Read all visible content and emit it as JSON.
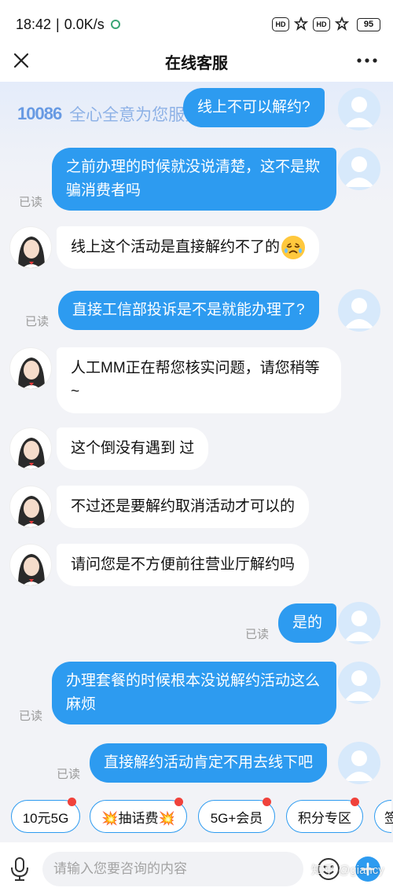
{
  "status_bar": {
    "time": "18:42",
    "network_speed": "0.0K/s",
    "icons": [
      "hd-icon",
      "signal-icon",
      "hd-icon",
      "signal-icon"
    ],
    "hd_label": "HD",
    "battery": "95"
  },
  "nav": {
    "title": "在线客服",
    "close_icon": "close-icon",
    "more_icon": "more-icon"
  },
  "banner": {
    "logo": "10086",
    "slogan": "全心全意为您服务"
  },
  "read_label": "已读",
  "messages": [
    {
      "from": "user",
      "text": "线上不可以解约?",
      "read": false
    },
    {
      "from": "user",
      "text": "之前办理的时候就没说清楚，这不是欺骗消费者吗",
      "read": true
    },
    {
      "from": "agent",
      "text": "线上这个活动是直接解约不了的"
    },
    {
      "from": "user",
      "text": "直接工信部投诉是不是就能办理了?",
      "read": true
    },
    {
      "from": "agent",
      "text": "人工MM正在帮您核实问题，请您稍等~"
    },
    {
      "from": "agent",
      "text": "这个倒没有遇到 过"
    },
    {
      "from": "agent",
      "text": "不过还是要解约取消活动才可以的"
    },
    {
      "from": "agent",
      "text": "请问您是不方便前往营业厅解约吗"
    },
    {
      "from": "user",
      "text": "是的",
      "read": true
    },
    {
      "from": "user",
      "text": "办理套餐的时候根本没说解约活动这么麻烦",
      "read": true
    },
    {
      "from": "user",
      "text": "直接解约活动肯定不用去线下吧",
      "read": true
    }
  ],
  "quick_replies": [
    {
      "label": "10元5G",
      "dot": true
    },
    {
      "label": "💥抽话费💥",
      "dot": true
    },
    {
      "label": "5G+会员",
      "dot": true
    },
    {
      "label": "积分专区",
      "dot": true
    },
    {
      "label": "签",
      "dot": false
    }
  ],
  "input": {
    "placeholder": "请输入您要咨询的内容",
    "mic_icon": "mic-icon",
    "emoji_icon": "emoji-icon",
    "plus_icon": "plus-icon"
  },
  "watermark": "知乎 @giancy",
  "colors": {
    "accent": "#2d9bf0",
    "badge": "#f0423b",
    "read_text": "#9a9a9a"
  }
}
